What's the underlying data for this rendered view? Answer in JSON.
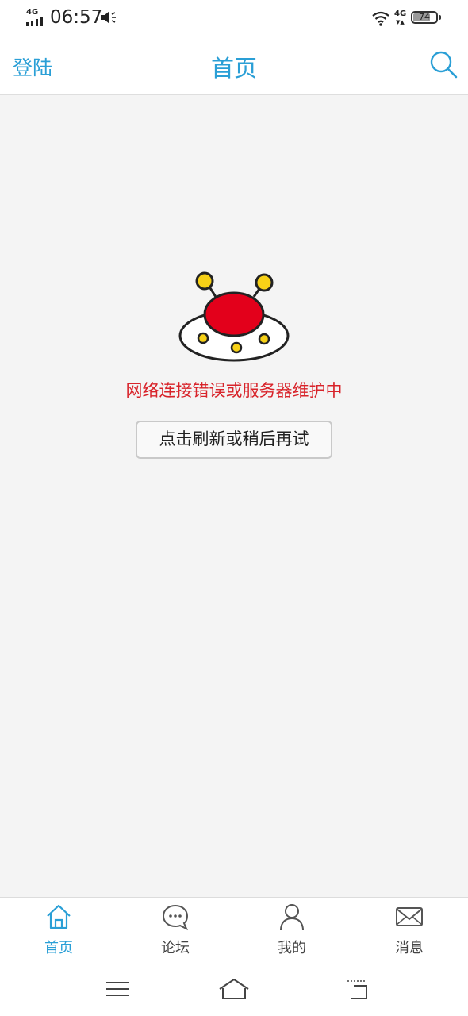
{
  "status_bar": {
    "signal_label": "4G",
    "time": "06:57",
    "network_right": "4G",
    "battery_level": 74,
    "battery_text": "74"
  },
  "header": {
    "login_label": "登陆",
    "title": "首页",
    "search_icon": "search-icon"
  },
  "error": {
    "illustration": "ufo-icon",
    "message": "网络连接错误或服务器维护中",
    "retry_label": "点击刷新或稍后再试"
  },
  "tabs": [
    {
      "label": "首页",
      "icon": "home-icon",
      "active": true
    },
    {
      "label": "论坛",
      "icon": "chat-bubble-icon",
      "active": false
    },
    {
      "label": "我的",
      "icon": "person-icon",
      "active": false
    },
    {
      "label": "消息",
      "icon": "envelope-icon",
      "active": false
    }
  ],
  "colors": {
    "accent": "#2a9fd6",
    "error": "#d8232a",
    "ufo_body": "#e3001b",
    "ufo_lights": "#f7d117"
  }
}
